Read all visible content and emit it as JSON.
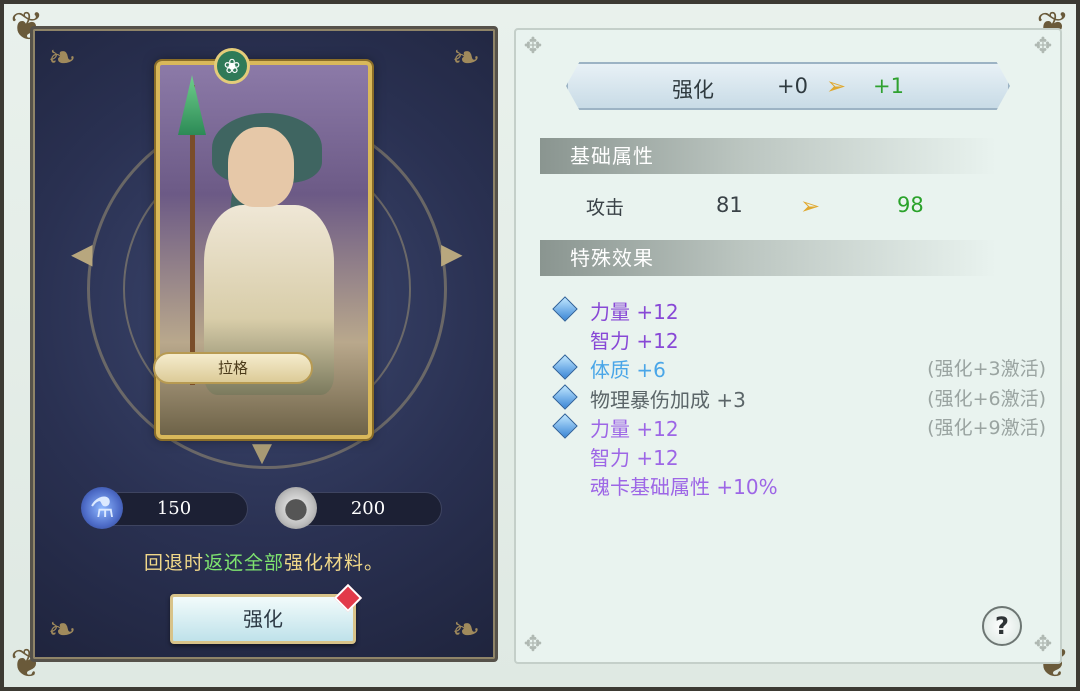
{
  "card": {
    "name": "拉格",
    "emblem_icon": "leaf-emblem-icon"
  },
  "resources": [
    {
      "icon": "potion-icon",
      "value": "150"
    },
    {
      "icon": "silver-coin-icon",
      "value": "200"
    }
  ],
  "note": {
    "prefix": "回退时",
    "highlight": "返还全部",
    "suffix": "强化材料。"
  },
  "enhance_button": {
    "label": "强化"
  },
  "level": {
    "label": "强化",
    "current": "+0",
    "next": "+1"
  },
  "sections": {
    "base": "基础属性",
    "special": "特殊效果"
  },
  "base_stats": [
    {
      "label": "攻击",
      "from": "81",
      "to": "98"
    }
  ],
  "effects": [
    {
      "gem": true,
      "text": "力量 +12",
      "color": "purple",
      "cond": ""
    },
    {
      "gem": false,
      "text": "智力 +12",
      "color": "purple",
      "cond": ""
    },
    {
      "gem": true,
      "text": "体质 +6",
      "color": "blue",
      "cond": "(强化+3激活)"
    },
    {
      "gem": true,
      "text": "物理暴伤加成 +3",
      "color": "gray",
      "cond": "(强化+6激活)"
    },
    {
      "gem": true,
      "text": "力量 +12",
      "color": "purple-light",
      "cond": "(强化+9激活)"
    },
    {
      "gem": false,
      "text": "智力 +12",
      "color": "purple-light",
      "cond": ""
    },
    {
      "gem": false,
      "text": "魂卡基础属性 +10%",
      "color": "purple-light",
      "cond": ""
    }
  ],
  "help": {
    "label": "?"
  },
  "colors": {
    "upgrade_green": "#2aa22a",
    "note_gold": "#f1d889",
    "note_green": "#7ee36f",
    "badge_red": "#e23a4a"
  }
}
